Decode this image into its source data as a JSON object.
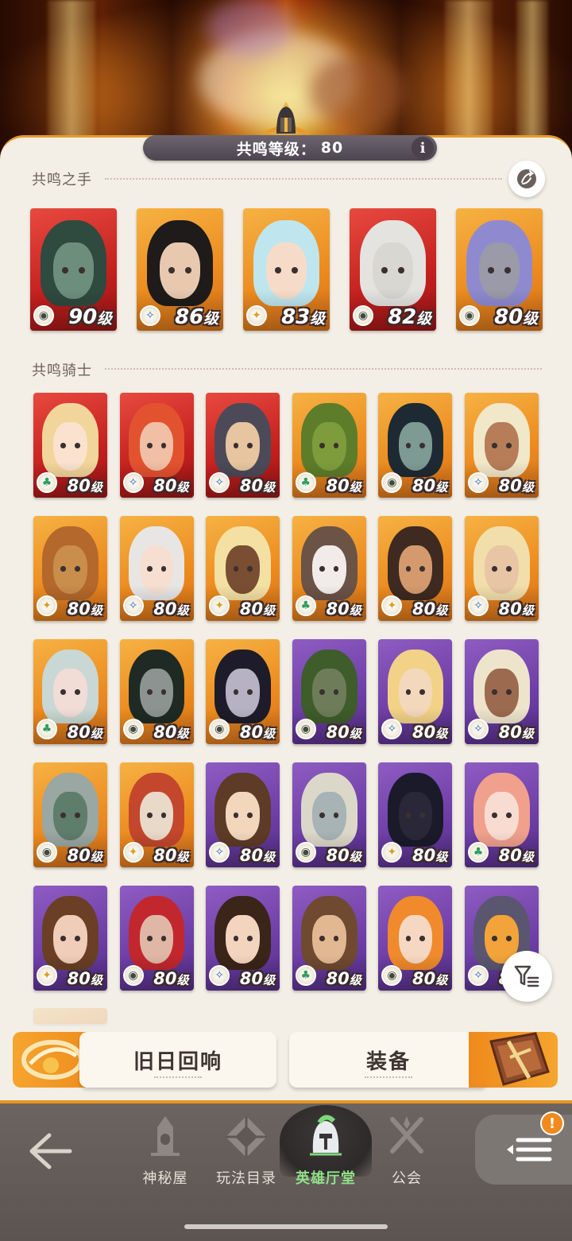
{
  "header": {
    "resonance_label": "共鸣等级：",
    "resonance_value": "80",
    "info_label": "i"
  },
  "sections": {
    "hands_title": "共鸣之手",
    "knights_title": "共鸣骑士"
  },
  "level_unit": "级",
  "hands": [
    {
      "name": "hero-1",
      "level": "90",
      "faction": "graveborn",
      "bg": "red",
      "hair": "#2f4a3f",
      "skin": "#6d8e7d"
    },
    {
      "name": "hero-2",
      "level": "86",
      "faction": "celestial",
      "bg": "gold",
      "hair": "#1f1b1b",
      "skin": "#e8c9b0"
    },
    {
      "name": "hero-3",
      "level": "83",
      "faction": "lightbearer",
      "bg": "gold",
      "hair": "#bfe6ee",
      "skin": "#f6dcc8"
    },
    {
      "name": "hero-4",
      "level": "82",
      "faction": "graveborn",
      "bg": "red",
      "hair": "#e4e3e0",
      "skin": "#d8d7d2"
    },
    {
      "name": "hero-5",
      "level": "80",
      "faction": "graveborn",
      "bg": "gold",
      "hair": "#8f8ad0",
      "skin": "#9a9aa8"
    }
  ],
  "knights": [
    {
      "name": "knight-1",
      "level": "80",
      "faction": "wilder",
      "bg": "red",
      "hair": "#f2d59a",
      "skin": "#fbe2cf"
    },
    {
      "name": "knight-2",
      "level": "80",
      "faction": "celestial",
      "bg": "red",
      "hair": "#e3522f",
      "skin": "#f1bfa5"
    },
    {
      "name": "knight-3",
      "level": "80",
      "faction": "celestial",
      "bg": "red",
      "hair": "#4c4a58",
      "skin": "#e6c5a0"
    },
    {
      "name": "knight-4",
      "level": "80",
      "faction": "wilder",
      "bg": "gold",
      "hair": "#5d7d2a",
      "skin": "#7e9c3c"
    },
    {
      "name": "knight-5",
      "level": "80",
      "faction": "graveborn",
      "bg": "gold",
      "hair": "#1e2a33",
      "skin": "#7d9a93"
    },
    {
      "name": "knight-6",
      "level": "80",
      "faction": "celestial",
      "bg": "gold",
      "hair": "#f1e7c9",
      "skin": "#b77d58"
    },
    {
      "name": "knight-7",
      "level": "80",
      "faction": "lightbearer",
      "bg": "gold",
      "hair": "#b5682b",
      "skin": "#c98d4c"
    },
    {
      "name": "knight-8",
      "level": "80",
      "faction": "celestial",
      "bg": "gold",
      "hair": "#e8e6e5",
      "skin": "#f6dfd1"
    },
    {
      "name": "knight-9",
      "level": "80",
      "faction": "lightbearer",
      "bg": "gold",
      "hair": "#f4e0a3",
      "skin": "#7a4e33"
    },
    {
      "name": "knight-10",
      "level": "80",
      "faction": "wilder",
      "bg": "gold",
      "hair": "#6b5346",
      "skin": "#f1ecea"
    },
    {
      "name": "knight-11",
      "level": "80",
      "faction": "lightbearer",
      "bg": "gold",
      "hair": "#3e2a20",
      "skin": "#d49a6e"
    },
    {
      "name": "knight-12",
      "level": "80",
      "faction": "celestial",
      "bg": "gold",
      "hair": "#f1deaa",
      "skin": "#e8c6a5"
    },
    {
      "name": "knight-13",
      "level": "80",
      "faction": "wilder",
      "bg": "gold",
      "hair": "#c9d8d4",
      "skin": "#f2dcd6"
    },
    {
      "name": "knight-14",
      "level": "80",
      "faction": "graveborn",
      "bg": "gold",
      "hair": "#1f2a24",
      "skin": "#8c9390"
    },
    {
      "name": "knight-15",
      "level": "80",
      "faction": "graveborn",
      "bg": "gold",
      "hair": "#1e1c2a",
      "skin": "#b6b2c4"
    },
    {
      "name": "knight-16",
      "level": "80",
      "faction": "graveborn",
      "bg": "purple",
      "hair": "#3e5d2a",
      "skin": "#6e7c5a"
    },
    {
      "name": "knight-17",
      "level": "80",
      "faction": "celestial",
      "bg": "purple",
      "hair": "#f2d287",
      "skin": "#f4d8bc"
    },
    {
      "name": "knight-18",
      "level": "80",
      "faction": "celestial",
      "bg": "purple",
      "hair": "#eee4cc",
      "skin": "#9c6a4e"
    },
    {
      "name": "knight-19",
      "level": "80",
      "faction": "graveborn",
      "bg": "gold",
      "hair": "#9aa7a2",
      "skin": "#5e7d6a"
    },
    {
      "name": "knight-20",
      "level": "80",
      "faction": "lightbearer",
      "bg": "gold",
      "hair": "#c3472d",
      "skin": "#e9d9c8"
    },
    {
      "name": "knight-21",
      "level": "80",
      "faction": "celestial",
      "bg": "purple",
      "hair": "#5e3b26",
      "skin": "#f2d7bd"
    },
    {
      "name": "knight-22",
      "level": "80",
      "faction": "graveborn",
      "bg": "purple",
      "hair": "#dcd8c9",
      "skin": "#a7b3b5"
    },
    {
      "name": "knight-23",
      "level": "80",
      "faction": "lightbearer",
      "bg": "purple",
      "hair": "#1b1a2b",
      "skin": "#2a2838"
    },
    {
      "name": "knight-24",
      "level": "80",
      "faction": "wilder",
      "bg": "purple",
      "hair": "#f1a08e",
      "skin": "#f9dcd1"
    },
    {
      "name": "knight-25",
      "level": "80",
      "faction": "lightbearer",
      "bg": "purple",
      "hair": "#6a3f25",
      "skin": "#f0cdb8"
    },
    {
      "name": "knight-26",
      "level": "80",
      "faction": "graveborn",
      "bg": "purple",
      "hair": "#c2272e",
      "skin": "#e0b7a6"
    },
    {
      "name": "knight-27",
      "level": "80",
      "faction": "celestial",
      "bg": "purple",
      "hair": "#3b2418",
      "skin": "#f3d4bf"
    },
    {
      "name": "knight-28",
      "level": "80",
      "faction": "wilder",
      "bg": "purple",
      "hair": "#6f4a30",
      "skin": "#e2b893"
    },
    {
      "name": "knight-29",
      "level": "80",
      "faction": "graveborn",
      "bg": "purple",
      "hair": "#f08a2c",
      "skin": "#f6d8c2"
    },
    {
      "name": "knight-30",
      "level": "80",
      "faction": "celestial",
      "bg": "purple",
      "hair": "#5b5670",
      "skin": "#f2a43a"
    }
  ],
  "buttons": {
    "echoes": "旧日回响",
    "equipment": "装备"
  },
  "nav": {
    "mystic_house": "神秘屋",
    "play_catalog": "玩法目录",
    "hero_hall": "英雄厅堂",
    "guild": "公会",
    "badge": "!"
  },
  "colors": {
    "accent": "#e8951e",
    "active_nav": "#8fe08a",
    "nav_bg": "#5f5855"
  }
}
